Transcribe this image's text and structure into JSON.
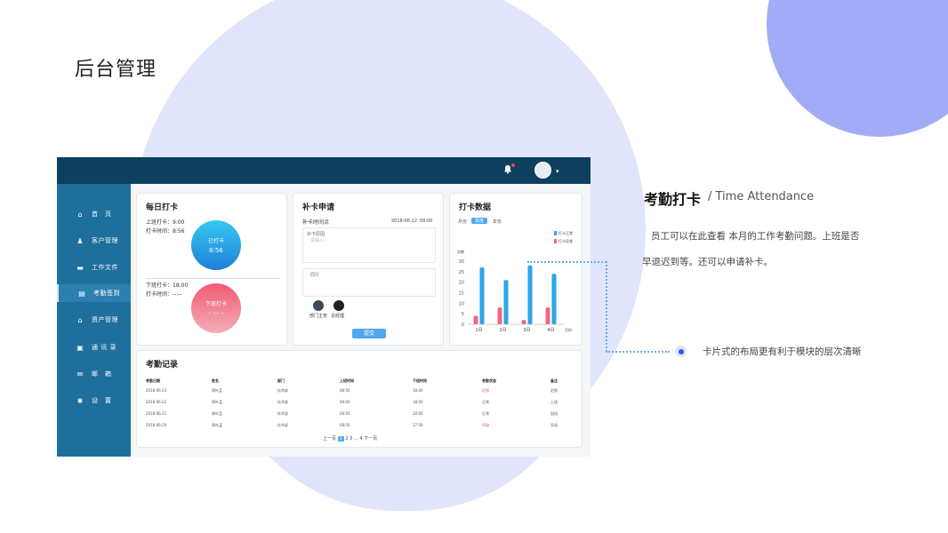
{
  "slide_title": "后台管理",
  "topbar": {
    "bell_icon": "bell-icon",
    "avatar_icon": "avatar-icon",
    "caret": "▾"
  },
  "sidebar": {
    "items": [
      {
        "label": "首　页",
        "icon": "home-icon",
        "glyph": "⌂"
      },
      {
        "label": "客户管理",
        "icon": "user-icon",
        "glyph": "♟"
      },
      {
        "label": "工作文件",
        "icon": "folder-icon",
        "glyph": "▬"
      },
      {
        "label": "考勤签到",
        "icon": "clipboard-icon",
        "glyph": "▤"
      },
      {
        "label": "资产管理",
        "icon": "house-icon",
        "glyph": "⌂"
      },
      {
        "label": "通 讯 录",
        "icon": "contacts-icon",
        "glyph": "▣"
      },
      {
        "label": "邮　箱",
        "icon": "mail-icon",
        "glyph": "✉"
      },
      {
        "label": "设　置",
        "icon": "gear-icon",
        "glyph": "✱"
      }
    ]
  },
  "daily": {
    "title": "每日打卡",
    "in_time": "上班打卡：9:00",
    "in_actual": "打卡时间：8:56",
    "in_btn_label": "已打卡",
    "in_btn_value": "8:56",
    "out_time": "下班打卡：18:00",
    "out_actual": "打卡时间：--:--",
    "out_btn_label": "下班打卡",
    "out_btn_value": "- -:- -"
  },
  "makeup": {
    "title": "补卡申请",
    "time_label": "补卡时间点",
    "date": "2018-06-12",
    "time": "09:00",
    "reason_label": "补卡原因",
    "reason_placeholder": "请输入...",
    "cc_label": "同行",
    "approver1": "部门主管",
    "approver2": "总经理",
    "submit": "提交"
  },
  "stats": {
    "title": "打卡数据",
    "tabs": [
      "月份",
      "季度",
      "年份"
    ],
    "active_tab": 1,
    "legend": [
      "打卡正常",
      "打卡异常"
    ],
    "ylabel": "次数"
  },
  "chart_data": {
    "type": "bar",
    "categories": [
      "1月",
      "2月",
      "3月",
      "4月"
    ],
    "series": [
      {
        "name": "打卡正常",
        "values": [
          27,
          21,
          28,
          24
        ]
      },
      {
        "name": "打卡异常",
        "values": [
          4,
          8,
          2,
          8
        ]
      }
    ],
    "xlabel": "月份",
    "ylabel": "次数",
    "yticks": [
      0,
      5,
      10,
      15,
      20,
      25,
      30
    ],
    "ylim": [
      0,
      30
    ],
    "legend": "top-right",
    "colors": [
      "#2aa7e6",
      "#f0687e"
    ]
  },
  "records": {
    "title": "考勤记录",
    "headers": [
      "考勤日期",
      "姓名",
      "部门",
      "上班时间",
      "下班时间",
      "考勤状态",
      "备注"
    ],
    "rows": [
      [
        "2018-06-23",
        "郑叶孟",
        "技术部",
        "08:56",
        "18:00",
        "迟到",
        "迟到"
      ],
      [
        "2018-06-22",
        "郑叶孟",
        "技术部",
        "09:00",
        "18:00",
        "正常",
        "上班"
      ],
      [
        "2018-06-21",
        "郑叶孟",
        "技术部",
        "08:50",
        "20:00",
        "正常",
        "加班"
      ],
      [
        "2018-06-20",
        "郑叶孟",
        "技术部",
        "08:50",
        "17:50",
        "早退",
        "早退"
      ]
    ],
    "red_status": [
      "迟到",
      "早退"
    ],
    "pager": {
      "prev": "上一页",
      "pages": [
        "1",
        "2",
        "3",
        "...",
        "4"
      ],
      "next": "下一页"
    }
  },
  "feature": {
    "title": "考勤打卡",
    "subtitle": "/  Time Attendance",
    "desc": "员工可以在此查看 本月的工作考勤问题。上班是否早退迟到等。还可以申请补卡。",
    "note": "卡片式的布局更有利于模块的层次清晰"
  }
}
